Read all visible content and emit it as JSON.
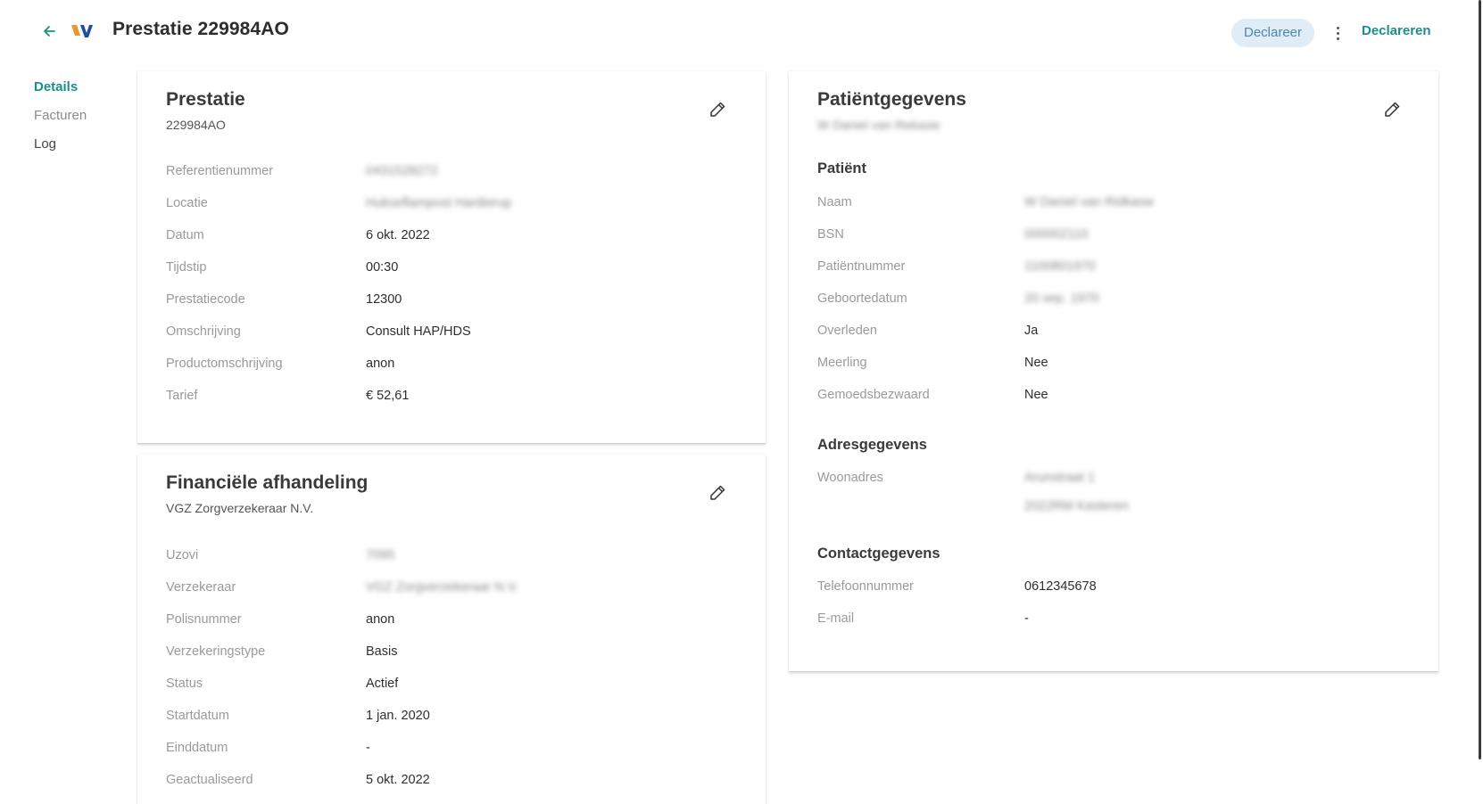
{
  "header": {
    "title": "Prestatie 229984AO",
    "status": "Declareer",
    "action": "Declareren"
  },
  "nav": {
    "details": "Details",
    "facturen": "Facturen",
    "log": "Log"
  },
  "prestatie": {
    "title": "Prestatie",
    "subtitle": "229984AO",
    "rows": [
      {
        "label": "Referentienummer",
        "value": "0431528272"
      },
      {
        "label": "Locatie",
        "value": "Hukseflampost Hardierup"
      },
      {
        "label": "Datum",
        "value": "6 okt. 2022"
      },
      {
        "label": "Tijdstip",
        "value": "00:30"
      },
      {
        "label": "Prestatiecode",
        "value": "12300"
      },
      {
        "label": "Omschrijving",
        "value": "Consult HAP/HDS"
      },
      {
        "label": "Productomschrijving",
        "value": "anon"
      },
      {
        "label": "Tarief",
        "value": "€ 52,61"
      }
    ]
  },
  "financieel": {
    "title": "Financiële afhandeling",
    "subtitle": "VGZ Zorgverzekeraar N.V.",
    "rows": [
      {
        "label": "Uzovi",
        "value": "7095"
      },
      {
        "label": "Verzekeraar",
        "value": "VGZ Zorgverzekeraar N.V."
      },
      {
        "label": "Polisnummer",
        "value": "anon"
      },
      {
        "label": "Verzekeringstype",
        "value": "Basis"
      },
      {
        "label": "Status",
        "value": "Actief"
      },
      {
        "label": "Startdatum",
        "value": "1 jan. 2020"
      },
      {
        "label": "Einddatum",
        "value": "-"
      },
      {
        "label": "Geactualiseerd",
        "value": "5 okt. 2022"
      }
    ]
  },
  "patient": {
    "title": "Patiëntgegevens",
    "subtitle": "W Daniel van Rekasie",
    "section_patient": "Patiënt",
    "rows": [
      {
        "label": "Naam",
        "value": "W Daniel van Ridkasw"
      },
      {
        "label": "BSN",
        "value": "000002110"
      },
      {
        "label": "Patiëntnummer",
        "value": "1100801970"
      },
      {
        "label": "Geboortedatum",
        "value": "20 sep. 1970"
      },
      {
        "label": "Overleden",
        "value": "Ja"
      },
      {
        "label": "Meerling",
        "value": "Nee"
      },
      {
        "label": "Gemoedsbezwaard",
        "value": "Nee"
      }
    ],
    "section_address": "Adresgegevens",
    "address": {
      "label": "Woonadres",
      "line1": "Arunstraat 1",
      "line2": "2022RM Kasteren"
    },
    "section_contact": "Contactgegevens",
    "contact": [
      {
        "label": "Telefoonnummer",
        "value": "0612345678"
      },
      {
        "label": "E-mail",
        "value": "-"
      }
    ]
  },
  "colors": {
    "accent": "#1a8f86",
    "chip_bg": "#e1edf6",
    "chip_text": "#4a86ad"
  }
}
